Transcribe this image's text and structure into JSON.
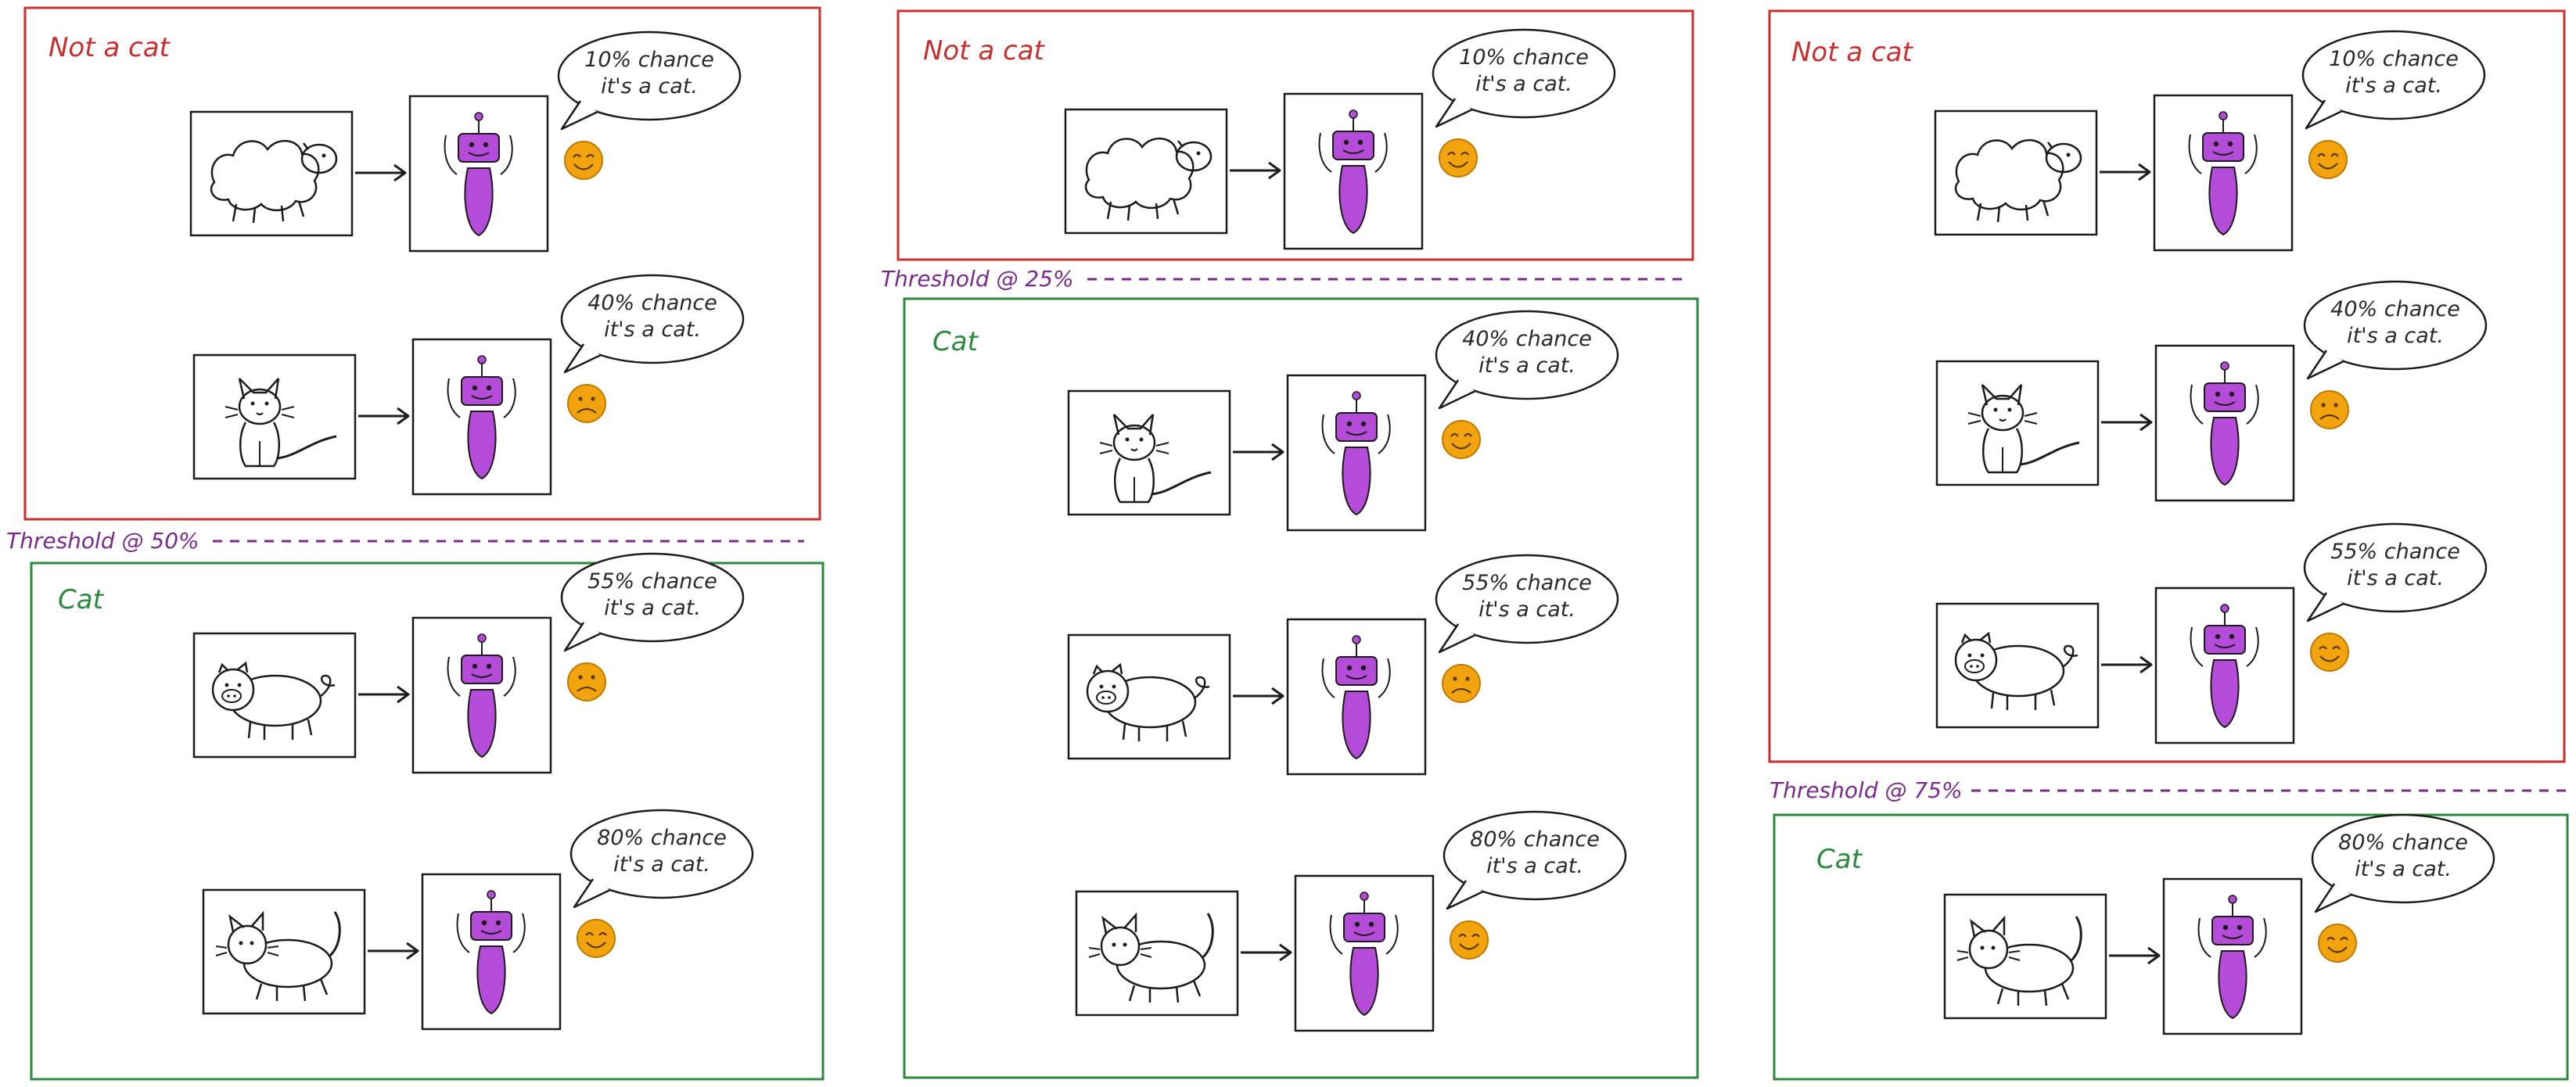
{
  "colors": {
    "not_cat": "#c8302f",
    "cat": "#2a8a3e",
    "threshold": "#7b2a8c",
    "robot": "#b54bd9",
    "emoji": "#f2a40f",
    "ink": "#1c1c1c"
  },
  "panels": [
    {
      "threshold_label": "Threshold @ 50%",
      "boxes": [
        {
          "label": "Not a cat",
          "kind": "not_cat",
          "rows": [
            {
              "animal": "sheep",
              "bubble": [
                "10% chance",
                "it's a cat."
              ],
              "face": "happy"
            },
            {
              "animal": "cat-sitting",
              "bubble": [
                "40% chance",
                "it's a cat."
              ],
              "face": "sad"
            }
          ]
        },
        {
          "label": "Cat",
          "kind": "cat",
          "rows": [
            {
              "animal": "pig",
              "bubble": [
                "55% chance",
                "it's a cat."
              ],
              "face": "sad"
            },
            {
              "animal": "cat-walking",
              "bubble": [
                "80% chance",
                "it's a cat."
              ],
              "face": "happy"
            }
          ]
        }
      ]
    },
    {
      "threshold_label": "Threshold @ 25%",
      "boxes": [
        {
          "label": "Not a cat",
          "kind": "not_cat",
          "rows": [
            {
              "animal": "sheep",
              "bubble": [
                "10% chance",
                "it's a cat."
              ],
              "face": "happy"
            }
          ]
        },
        {
          "label": "Cat",
          "kind": "cat",
          "rows": [
            {
              "animal": "cat-sitting",
              "bubble": [
                "40% chance",
                "it's a cat."
              ],
              "face": "happy"
            },
            {
              "animal": "pig",
              "bubble": [
                "55% chance",
                "it's a cat."
              ],
              "face": "sad"
            },
            {
              "animal": "cat-walking",
              "bubble": [
                "80% chance",
                "it's a cat."
              ],
              "face": "happy"
            }
          ]
        }
      ]
    },
    {
      "threshold_label": "Threshold @ 75%",
      "boxes": [
        {
          "label": "Not a cat",
          "kind": "not_cat",
          "rows": [
            {
              "animal": "sheep",
              "bubble": [
                "10% chance",
                "it's a cat."
              ],
              "face": "happy"
            },
            {
              "animal": "cat-sitting",
              "bubble": [
                "40% chance",
                "it's a cat."
              ],
              "face": "sad"
            },
            {
              "animal": "pig",
              "bubble": [
                "55% chance",
                "it's a cat."
              ],
              "face": "happy"
            }
          ]
        },
        {
          "label": "Cat",
          "kind": "cat",
          "rows": [
            {
              "animal": "cat-walking",
              "bubble": [
                "80% chance",
                "it's a cat."
              ],
              "face": "happy"
            }
          ]
        }
      ]
    }
  ]
}
